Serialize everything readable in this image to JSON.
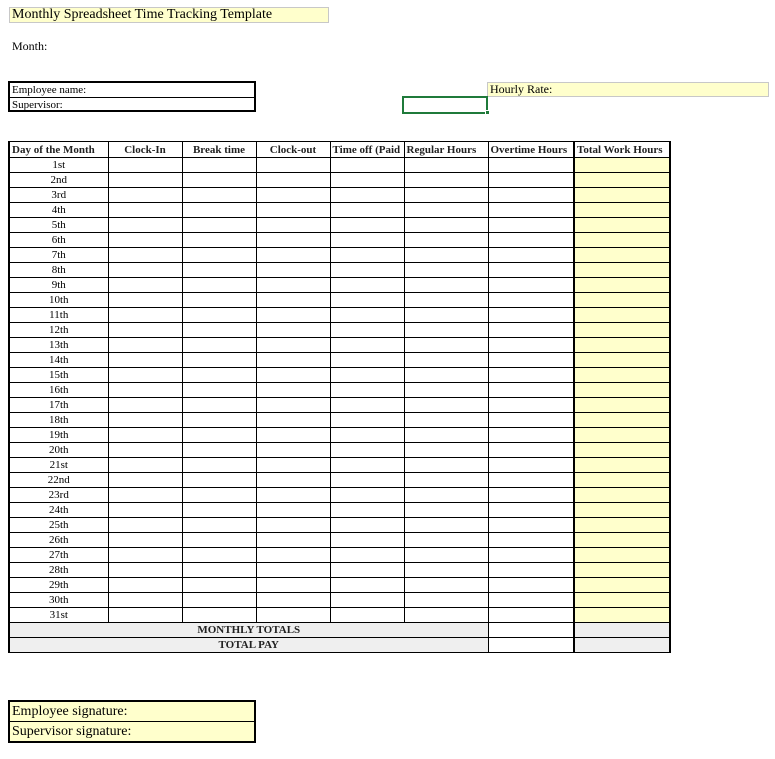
{
  "title": "Monthly Spreadsheet Time Tracking Template",
  "month_label": "Month:",
  "employee_label": "Employee name:",
  "supervisor_label": "Supervisor:",
  "hourly_rate_label": "Hourly Rate:",
  "columns": [
    "Day of the Month",
    "Clock-In",
    "Break time",
    "Clock-out",
    "Time off (Paid",
    "Regular Hours",
    "Overtime Hours",
    "Total Work Hours"
  ],
  "days": [
    "1st",
    "2nd",
    "3rd",
    "4th",
    "5th",
    "6th",
    "7th",
    "8th",
    "9th",
    "10th",
    "11th",
    "12th",
    "13th",
    "14th",
    "15th",
    "16th",
    "17th",
    "18th",
    "19th",
    "20th",
    "21st",
    "22nd",
    "23rd",
    "24th",
    "25th",
    "26th",
    "27th",
    "28th",
    "29th",
    "30th",
    "31st"
  ],
  "monthly_totals_label": "MONTHLY TOTALS",
  "total_pay_label": "TOTAL PAY",
  "employee_signature_label": "Employee signature:",
  "supervisor_signature_label": "Supervisor signature:",
  "colors": {
    "input_fill": "#ffffcc",
    "totals_fill": "#efefef",
    "selection": "#1f7a3a"
  }
}
